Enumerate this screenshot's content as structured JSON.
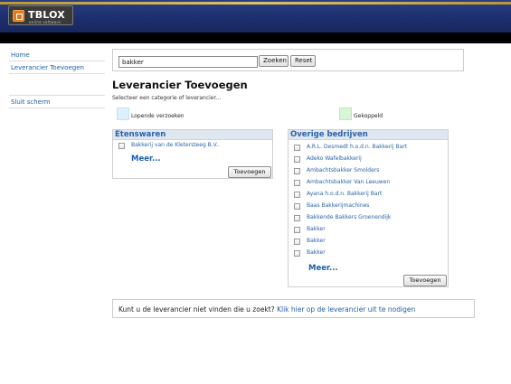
{
  "header": {
    "logo_text": "TBLOX",
    "logo_sub": "online software"
  },
  "sidebar": {
    "items": [
      {
        "label": "Home"
      },
      {
        "label": "Leverancier Toevoegen"
      },
      {
        "label": "Sluit scherm"
      }
    ]
  },
  "search": {
    "value": "bakker",
    "search_label": "Zoeken",
    "reset_label": "Reset"
  },
  "page": {
    "title": "Leverancier Toevoegen",
    "subtitle": "Selecteer een categorie of leverancier..."
  },
  "legend": {
    "pending_label": "Lopende verzoeken",
    "pending_color": "#dcf1fb",
    "linked_label": "Gekoppeld",
    "linked_color": "#d8f5d6"
  },
  "panels": {
    "left": {
      "title": "Etenswaren",
      "items": [
        "Bakkerij van de Kletersteeg B.V.."
      ],
      "more_label": "Meer...",
      "add_label": "Toevoegen"
    },
    "right": {
      "title": "Overige bedrijven",
      "items": [
        "A.R.L. Desmedt h.o.d.n. Bakkerij Bart",
        "Adeko Wafelbakkerij",
        "Ambachtsbakker Smolders",
        "Ambachtsbakker Van Leeuwen",
        "Ayana h.o.d.n. Bakkerij Bart",
        "Baas Bakkerijmachines",
        "Bakkende Bakkers Groenendijk",
        "Bakker",
        "Bakker ",
        "Bakker"
      ],
      "more_label": "Meer...",
      "add_label": "Toevoegen"
    }
  },
  "footer": {
    "question": "Kunt u de leverancier niet vinden die u zoekt? ",
    "invite_link": "Klik hier op de leverancier uit te nodigen"
  }
}
